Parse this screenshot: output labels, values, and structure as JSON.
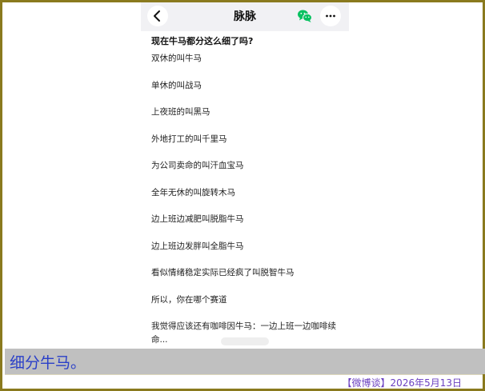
{
  "app": {
    "title": "脉脉",
    "back_icon": "chevron-left-icon",
    "share_icon": "wechat-icon",
    "more_icon": "more-dots-icon",
    "wechat_color": "#07c160"
  },
  "post": {
    "question": "现在牛马都分这么细了吗?",
    "lines": [
      "双休的叫牛马",
      "单休的叫战马",
      "上夜班的叫黑马",
      "外地打工的叫千里马",
      "为公司卖命的叫汗血宝马",
      "全年无休的叫旋转木马",
      "边上班边减肥叫脱脂牛马",
      "边上班边发胖叫全脂牛马",
      "看似情绪稳定实际已经疯了叫脱智牛马",
      "所以，你在哪个赛道"
    ],
    "last_line": "我觉得应该还有咖啡因牛马：一边上班一边咖啡续命..."
  },
  "caption": {
    "text": "细分牛马。",
    "color": "#2a3fc8"
  },
  "footer": {
    "text": "【微博谈】2026年5月13日"
  }
}
